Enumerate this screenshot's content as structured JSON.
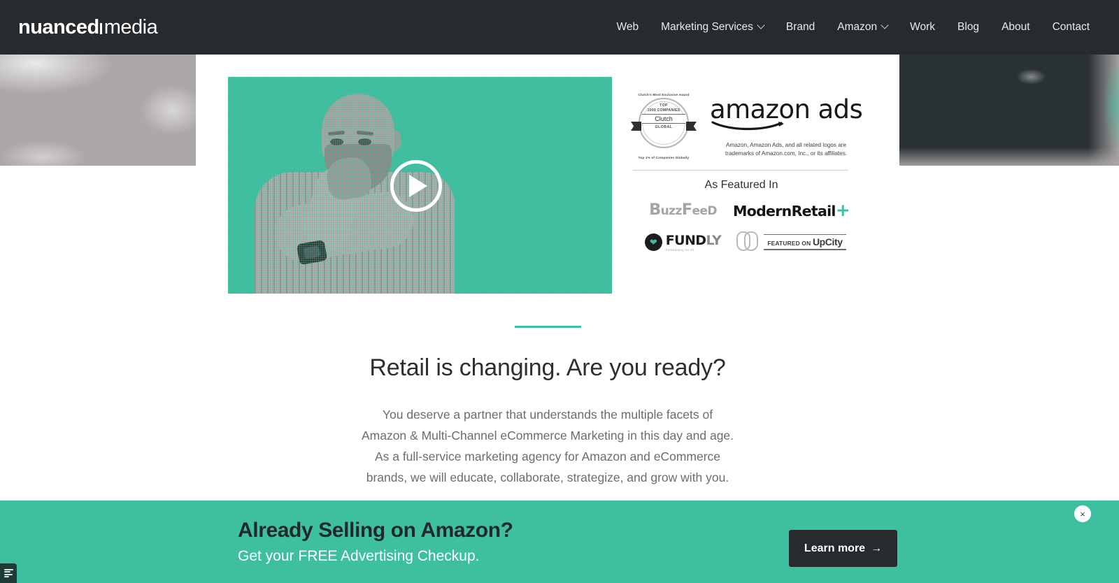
{
  "header": {
    "logo": {
      "bold": "nuanced",
      "light": "media"
    },
    "nav": [
      {
        "label": "Web",
        "has_dropdown": false
      },
      {
        "label": "Marketing Services",
        "has_dropdown": true
      },
      {
        "label": "Brand",
        "has_dropdown": false
      },
      {
        "label": "Amazon",
        "has_dropdown": true
      },
      {
        "label": "Work",
        "has_dropdown": false
      },
      {
        "label": "Blog",
        "has_dropdown": false
      },
      {
        "label": "About",
        "has_dropdown": false
      },
      {
        "label": "Contact",
        "has_dropdown": false
      }
    ]
  },
  "video": {
    "play_label": "Play video"
  },
  "awards": {
    "clutch": {
      "arc_top": "Clutch's Most Exclusive Award",
      "line1": "TOP",
      "line2": "1000 COMPANIES",
      "brand": "Clutch",
      "scope": "GLOBAL",
      "arc_bottom": "Top 1% of Companies Globally"
    },
    "amazon_ads": {
      "word_amazon": "amazon",
      "word_ads": "ads",
      "legal_line1": "Amazon, Amazon Ads, and all related logos are",
      "legal_line2": "trademarks of Amazon.com, Inc., or its affiliates."
    },
    "featured_title": "As Featured In",
    "featured_logos": [
      {
        "name": "BuzzFeed",
        "main": "B",
        "rest": "uzz",
        "cap2": "F",
        "rest2": "ee",
        "small": "D"
      },
      {
        "name": "ModernRetail",
        "text": "ModernRetail",
        "plus": "+"
      },
      {
        "name": "Fundly",
        "text": "FUND",
        "suffix": "LY",
        "tagline": "Fundraising for All"
      },
      {
        "name": "UpCity",
        "prefix": "FEATURED ON",
        "brand": "UpCity"
      }
    ]
  },
  "intro": {
    "title": "Retail is changing. Are you ready?",
    "body_line1": "You deserve a partner that understands the multiple facets of",
    "body_line2": "Amazon & Multi-Channel eCommerce Marketing  in this day and age.",
    "body_line3": "As a full-service marketing agency for Amazon and eCommerce",
    "body_line4": "brands, we will educate, collaborate, strategize, and grow with you."
  },
  "banner": {
    "title": "Already Selling on Amazon?",
    "subtitle": "Get your FREE Advertising Checkup.",
    "cta_label": "Learn more",
    "cta_arrow": "→",
    "close_label": "×"
  },
  "colors": {
    "teal": "#3ec0a0",
    "dark": "#272b2e",
    "body_text": "#6a6d6f",
    "heading": "#2b2f31"
  }
}
